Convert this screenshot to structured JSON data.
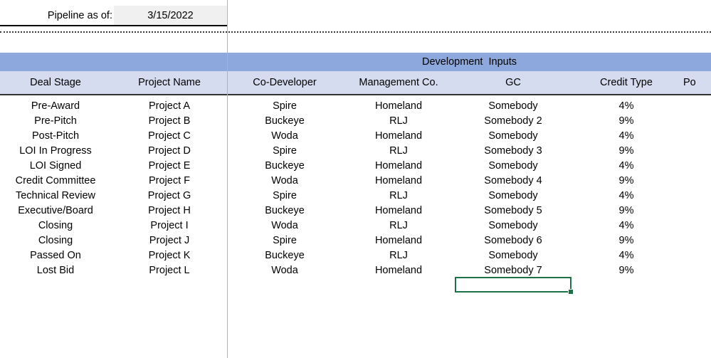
{
  "titlebar": {
    "label": "Pipeline as of:",
    "date_value": "3/15/2022"
  },
  "group_header": {
    "label": "Development  Inputs"
  },
  "columns": [
    {
      "key": "deal_stage",
      "label": "Deal Stage"
    },
    {
      "key": "project",
      "label": "Project Name"
    },
    {
      "key": "co_dev",
      "label": "Co-Developer"
    },
    {
      "key": "mgmt_co",
      "label": "Management Co."
    },
    {
      "key": "gc",
      "label": "GC"
    },
    {
      "key": "credit_type",
      "label": "Credit Type"
    },
    {
      "key": "clipped",
      "label": "Po"
    }
  ],
  "rows": [
    {
      "deal_stage": "Pre-Award",
      "project": "Project A",
      "co_dev": "Spire",
      "mgmt_co": "Homeland",
      "gc": "Somebody",
      "credit_type": "4%"
    },
    {
      "deal_stage": "Pre-Pitch",
      "project": "Project B",
      "co_dev": "Buckeye",
      "mgmt_co": "RLJ",
      "gc": "Somebody 2",
      "credit_type": "9%"
    },
    {
      "deal_stage": "Post-Pitch",
      "project": "Project C",
      "co_dev": "Woda",
      "mgmt_co": "Homeland",
      "gc": "Somebody",
      "credit_type": "4%"
    },
    {
      "deal_stage": "LOI In Progress",
      "project": "Project D",
      "co_dev": "Spire",
      "mgmt_co": "RLJ",
      "gc": "Somebody 3",
      "credit_type": "9%"
    },
    {
      "deal_stage": "LOI Signed",
      "project": "Project E",
      "co_dev": "Buckeye",
      "mgmt_co": "Homeland",
      "gc": "Somebody",
      "credit_type": "4%"
    },
    {
      "deal_stage": "Credit Committee",
      "project": "Project F",
      "co_dev": "Woda",
      "mgmt_co": "Homeland",
      "gc": "Somebody 4",
      "credit_type": "9%"
    },
    {
      "deal_stage": "Technical Review",
      "project": "Project G",
      "co_dev": "Spire",
      "mgmt_co": "RLJ",
      "gc": "Somebody",
      "credit_type": "4%"
    },
    {
      "deal_stage": "Executive/Board",
      "project": "Project H",
      "co_dev": "Buckeye",
      "mgmt_co": "Homeland",
      "gc": "Somebody 5",
      "credit_type": "9%"
    },
    {
      "deal_stage": "Closing",
      "project": "Project I",
      "co_dev": "Woda",
      "mgmt_co": "RLJ",
      "gc": "Somebody",
      "credit_type": "4%"
    },
    {
      "deal_stage": "Closing",
      "project": "Project J",
      "co_dev": "Spire",
      "mgmt_co": "Homeland",
      "gc": "Somebody 6",
      "credit_type": "9%"
    },
    {
      "deal_stage": "Passed On",
      "project": "Project K",
      "co_dev": "Buckeye",
      "mgmt_co": "RLJ",
      "gc": "Somebody",
      "credit_type": "4%"
    },
    {
      "deal_stage": "Lost Bid",
      "project": "Project L",
      "co_dev": "Woda",
      "mgmt_co": "Homeland",
      "gc": "Somebody 7",
      "credit_type": "9%"
    }
  ],
  "selection": {
    "column": "gc",
    "value": ""
  },
  "colors": {
    "group_band": "#8CA8DC",
    "column_header": "#D6DCF0",
    "date_cell": "#F0F0F0",
    "selection_outline": "#1E7145",
    "pane_divider": "#B2B2B2"
  }
}
